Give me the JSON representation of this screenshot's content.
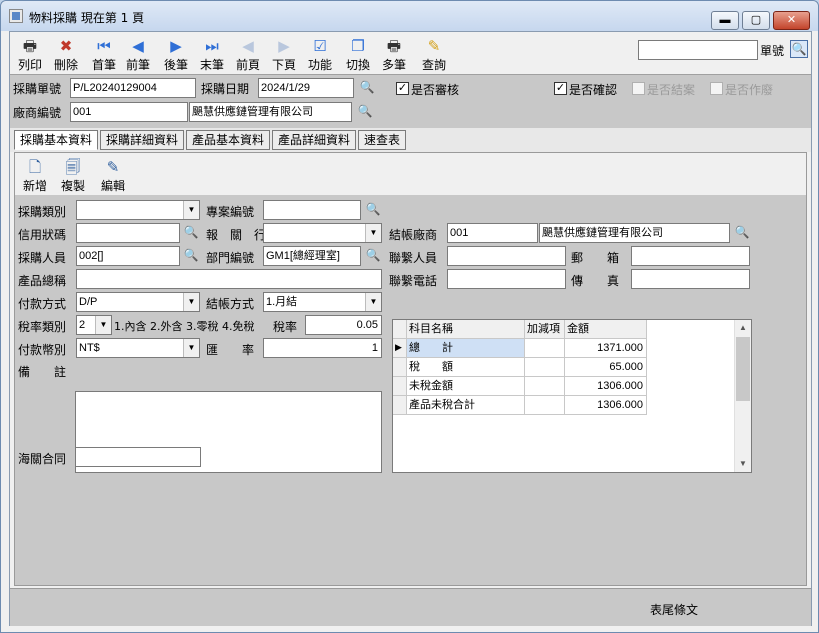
{
  "window": {
    "title": "物料採購 現在第 1 頁",
    "min": "▬",
    "max": "▢",
    "close": "✕"
  },
  "toolbar": {
    "items": [
      {
        "label": "列印",
        "icon": "printer-icon",
        "glyph": "🖶",
        "color": "#333"
      },
      {
        "label": "刪除",
        "icon": "delete-icon",
        "glyph": "✖",
        "color": "#c0392b"
      },
      {
        "label": "首筆",
        "icon": "first-record-icon",
        "glyph": "⏮",
        "color": "#2f6fd6"
      },
      {
        "label": "前筆",
        "icon": "previous-record-icon",
        "glyph": "◀",
        "color": "#2f6fd6"
      },
      {
        "label": "後筆",
        "icon": "next-record-icon",
        "glyph": "▶",
        "color": "#2f6fd6"
      },
      {
        "label": "末筆",
        "icon": "last-record-icon",
        "glyph": "⏭",
        "color": "#2f6fd6"
      },
      {
        "label": "前頁",
        "icon": "previous-page-icon",
        "glyph": "◀",
        "color": "#b9c7dd"
      },
      {
        "label": "下頁",
        "icon": "next-page-icon",
        "glyph": "▶",
        "color": "#b9c7dd"
      },
      {
        "label": "功能",
        "icon": "function-icon",
        "glyph": "☑",
        "color": "#2f6fd6"
      },
      {
        "label": "切換",
        "icon": "switch-icon",
        "glyph": "❐",
        "color": "#2f6fd6"
      },
      {
        "label": "多筆",
        "icon": "multi-print-icon",
        "glyph": "🖶",
        "color": "#333"
      },
      {
        "label": "查詢",
        "icon": "query-icon",
        "glyph": "✎",
        "color": "#d4a017"
      }
    ],
    "search_value": "",
    "search_label": "單號",
    "search_icon": "🔍"
  },
  "header": {
    "order_no_label": "採購單號",
    "order_no": "P/L20240129004",
    "order_date_label": "採購日期",
    "order_date": "2024/1/29",
    "vendor_no_label": "廠商編號",
    "vendor_no": "001",
    "vendor_name": "颶慧供應鏈管理有限公司",
    "reviewed_label": "是否審核",
    "reviewed": "✓",
    "confirmed_label": "是否確認",
    "confirmed": "✓",
    "closed_label": "是否結案",
    "closed": "",
    "voided_label": "是否作廢",
    "voided": ""
  },
  "tabs": [
    {
      "label": "採購基本資料",
      "active": true
    },
    {
      "label": "採購詳細資料",
      "active": false
    },
    {
      "label": "產品基本資料",
      "active": false
    },
    {
      "label": "產品詳細資料",
      "active": false
    },
    {
      "label": "速查表",
      "active": false
    }
  ],
  "subtoolbar": [
    {
      "label": "新增",
      "icon": "new-document-icon",
      "glyph": "🗋"
    },
    {
      "label": "複製",
      "icon": "copy-document-icon",
      "glyph": "🗐"
    },
    {
      "label": "編輯",
      "icon": "edit-document-icon",
      "glyph": "✎"
    }
  ],
  "form": {
    "purchase_type_label": "採購類別",
    "purchase_type": "",
    "project_no_label": "專案編號",
    "project_no": "",
    "credit_label": "信用狀碼",
    "credit": "",
    "customs_agent_label": "報　關　行",
    "customs_agent": "",
    "settle_vendor_label": "結帳廠商",
    "settle_vendor_no": "001",
    "settle_vendor_name": "颶慧供應鏈管理有限公司",
    "buyer_label": "採購人員",
    "buyer": "002[]",
    "dept_label": "部門編號",
    "dept": "GM1[總經理室]",
    "contact_label": "聯繫人員",
    "contact": "",
    "email_label": "郵　　箱",
    "email": "",
    "product_name_label": "產品總稱",
    "product_name": "",
    "contact_phone_label": "聯繫電話",
    "contact_phone": "",
    "fax_label": "傳　　真",
    "fax": "",
    "payment_label": "付款方式",
    "payment": "D/P",
    "settle_method_label": "結帳方式",
    "settle_method": "1.月結",
    "tax_type_label": "稅率類別",
    "tax_type": "2",
    "tax_type_desc": "1.內含 2.外含 3.零稅 4.免稅",
    "tax_rate_label": "稅率",
    "tax_rate": "0.05",
    "currency_label": "付款幣別",
    "currency": "NT$",
    "exchange_label": "匯　　率",
    "exchange": "1",
    "remark_label": "備　　註",
    "remark": "",
    "customs_contract_label": "海關合同",
    "customs_contract": ""
  },
  "summary": {
    "columns": [
      "科目名稱",
      "加減項",
      "金額"
    ],
    "rows": [
      {
        "name": "總　　計",
        "adj": "",
        "amount": "1371.000"
      },
      {
        "name": "稅　　額",
        "adj": "",
        "amount": "65.000"
      },
      {
        "name": "未稅金額",
        "adj": "",
        "amount": "1306.000"
      },
      {
        "name": "產品未稅合計",
        "adj": "",
        "amount": "1306.000"
      }
    ],
    "row_marker": "▶"
  },
  "footer": {
    "label": "表尾條文"
  }
}
